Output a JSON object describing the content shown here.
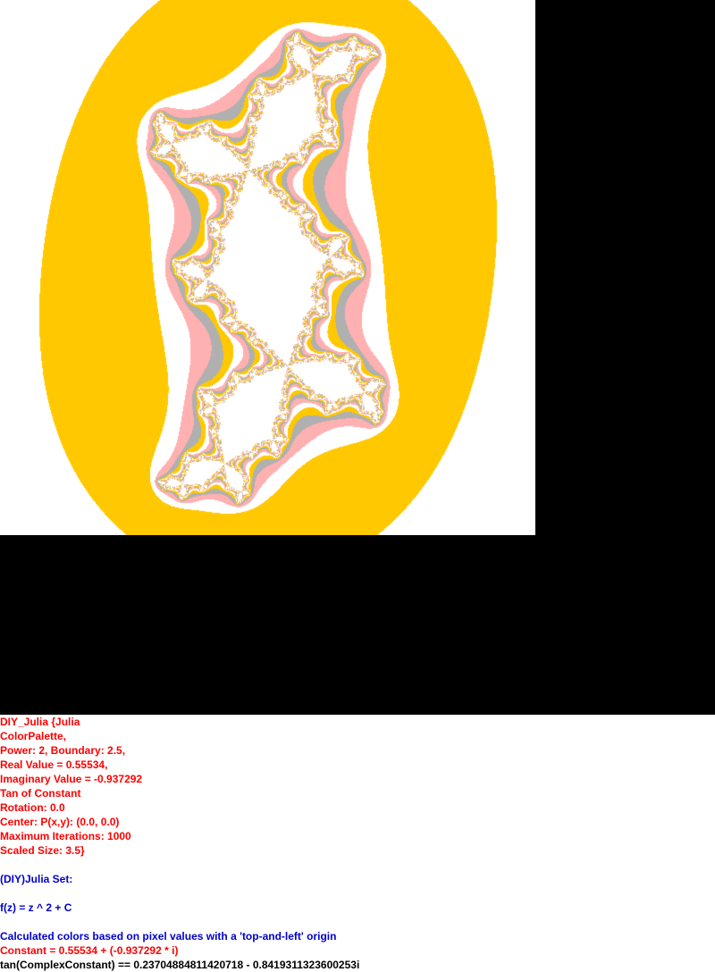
{
  "colors": {
    "background_gray": "#c0c0c0",
    "outer_white": "#ffffff",
    "ring_gold": "#ffc800",
    "ring_pink": "#ffb0b0",
    "ring_gray": "#b0b0b0",
    "canvas_black": "#000000",
    "text_red": "#ff0000",
    "text_blue": "#0000cc",
    "text_black": "#000000"
  },
  "parameters": {
    "header": "DIY_Julia {Julia",
    "palette": "ColorPalette,",
    "power_boundary": "Power: 2, Boundary: 2.5,",
    "real_value": "Real Value = 0.55534,",
    "imaginary_value": "Imaginary Value = -0.937292",
    "tan_of_constant": "Tan of Constant",
    "rotation": "Rotation: 0.0",
    "center": "Center: P(x,y): (0.0, 0.0)",
    "max_iterations": "Maximum Iterations: 1000",
    "scaled_size": "Scaled Size: 3.5}"
  },
  "description": {
    "set_title": "(DIY)Julia Set:",
    "formula": "f(z) = z ^ 2 + C",
    "color_note": "Calculated colors based on pixel values with a 'top-and-left' origin",
    "constant": "Constant = 0.55534 + (-0.937292 * i)",
    "tan_result": "tan(ComplexConstant) == 0.23704884811420718 - 0.8419311323600253i"
  },
  "fractal": {
    "power": 2,
    "boundary": 2.5,
    "real": 0.55534,
    "imaginary": -0.937292,
    "rotation": 0.0,
    "center": [
      0.0,
      0.0
    ],
    "max_iterations": 1000,
    "scaled_size": 3.5
  }
}
